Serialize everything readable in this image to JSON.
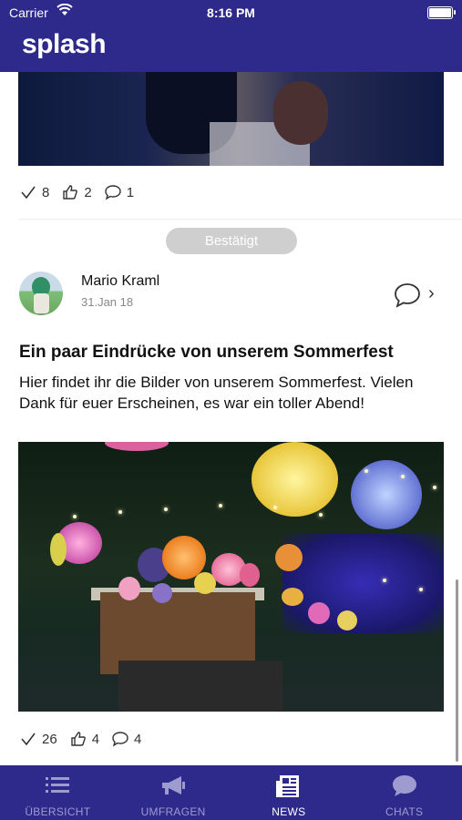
{
  "status_bar": {
    "carrier": "Carrier",
    "time": "8:16 PM"
  },
  "app": {
    "brand": "splash"
  },
  "post1": {
    "stats": {
      "confirms": "8",
      "likes": "2",
      "comments": "1"
    }
  },
  "confirm_button": {
    "label": "Bestätigt"
  },
  "post2": {
    "author": "Mario Kraml",
    "date": "31.Jan 18",
    "title": "Ein paar Eindrücke von unserem Sommerfest",
    "body": "Hier findet ihr die Bilder von unserem Sommerfest. Vielen Dank für euer Erscheinen, es war ein toller Abend!",
    "stats": {
      "confirms": "26",
      "likes": "4",
      "comments": "4"
    }
  },
  "tabs": [
    {
      "label": "ÜBERSICHT",
      "icon": "list-icon",
      "active": false
    },
    {
      "label": "UMFRAGEN",
      "icon": "megaphone-icon",
      "active": false
    },
    {
      "label": "NEWS",
      "icon": "newspaper-icon",
      "active": true
    },
    {
      "label": "CHATS",
      "icon": "chat-bubble-icon",
      "active": false
    }
  ],
  "colors": {
    "brand": "#2e2a8c",
    "tab_inactive": "#9e9bd0",
    "tab_active": "#ffffff",
    "confirm_bg": "#cfcfcf"
  }
}
